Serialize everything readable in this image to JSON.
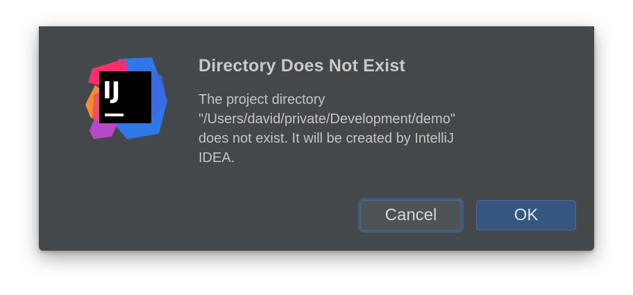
{
  "dialog": {
    "logo_text": "IJ",
    "title": "Directory Does Not Exist",
    "message_lines": [
      "The project directory",
      "\"/Users/david/private/Development/demo\"",
      "does not exist. It will be created by IntelliJ",
      "IDEA."
    ],
    "buttons": {
      "cancel_label": "Cancel",
      "ok_label": "OK"
    }
  },
  "colors": {
    "dialog_bg": "#45484b",
    "default_button": "#365880",
    "focus_ring": "#3c5d85"
  },
  "icons": {
    "app_logo": "intellij-idea-logo-icon"
  }
}
